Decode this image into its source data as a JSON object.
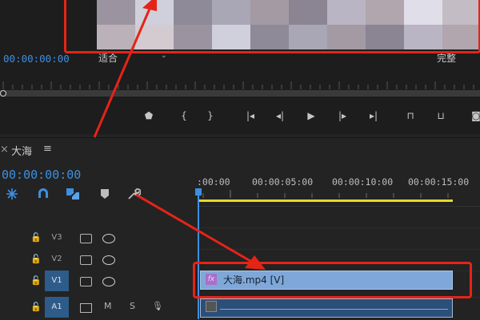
{
  "monitor": {
    "timecode": "00:00:00:00",
    "fit_select": "适合",
    "quality_select": "完整",
    "transport": [
      {
        "name": "add-marker-icon",
        "glyph": "⬟"
      },
      {
        "name": "mark-in-icon",
        "glyph": "{"
      },
      {
        "name": "mark-out-icon",
        "glyph": "}"
      },
      {
        "name": "go-to-in-icon",
        "glyph": "|◂"
      },
      {
        "name": "step-back-icon",
        "glyph": "◂|"
      },
      {
        "name": "play-icon",
        "glyph": "▶"
      },
      {
        "name": "step-forward-icon",
        "glyph": "|▸"
      },
      {
        "name": "go-to-out-icon",
        "glyph": "▸|"
      },
      {
        "name": "lift-icon",
        "glyph": "⊓"
      },
      {
        "name": "extract-icon",
        "glyph": "⊔"
      },
      {
        "name": "export-frame-icon",
        "glyph": "◙"
      }
    ]
  },
  "timeline": {
    "close_glyph": "×",
    "sequence_name": "大海",
    "menu_glyph": "≡",
    "timecode": "00:00:00:00",
    "ruler_labels": [
      ":00:00",
      "00:00:05:00",
      "00:00:10:00",
      "00:00:15:00"
    ],
    "tracks": [
      {
        "name": "V3",
        "active": false
      },
      {
        "name": "V2",
        "active": false
      },
      {
        "name": "V1",
        "active": true
      },
      {
        "name": "A1",
        "active": true,
        "audio": true
      }
    ],
    "audio_buttons": {
      "mute": "M",
      "solo": "S"
    },
    "clip": {
      "fx": "fx",
      "label": "大海.mp4 [V]"
    }
  },
  "colors": {
    "timecode": "#3d8fe0",
    "highlight": "#e52418",
    "work_area": "#e5da2a",
    "video_clip": "#7fa8d9",
    "audio_clip": "#2a4f79"
  }
}
